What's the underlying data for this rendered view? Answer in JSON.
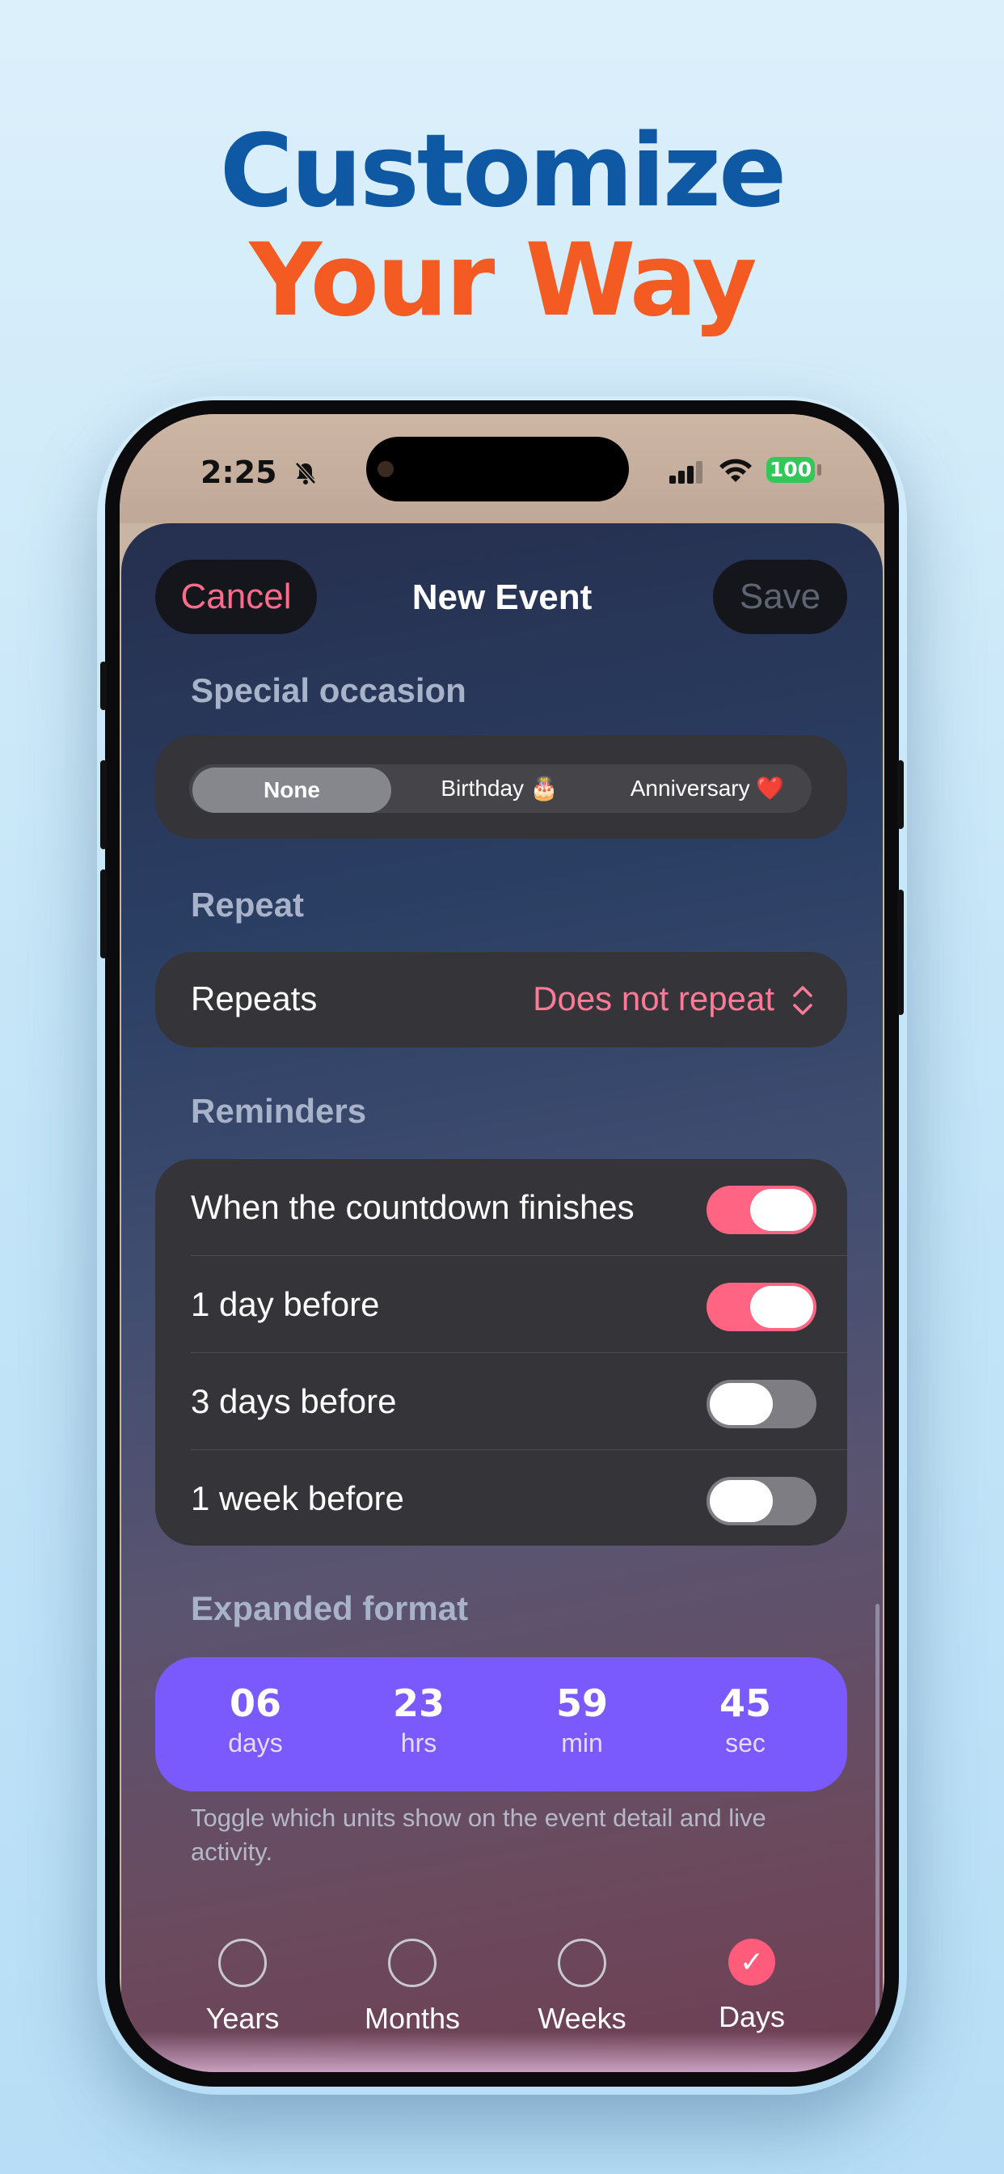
{
  "headline": {
    "line1": "Customize",
    "line2": "Your Way",
    "line1_color": "#0e58a4",
    "line2_color": "#f35b22"
  },
  "status_bar": {
    "time": "2:25",
    "battery": "100",
    "silent_icon": "bell-slash-icon"
  },
  "nav": {
    "cancel": "Cancel",
    "title": "New Event",
    "save": "Save"
  },
  "special_occasion": {
    "label": "Special occasion",
    "options": [
      "None",
      "Birthday 🎂",
      "Anniversary ❤️"
    ],
    "selected": "None"
  },
  "repeat": {
    "label": "Repeat",
    "row_label": "Repeats",
    "value": "Does not repeat"
  },
  "reminders": {
    "label": "Reminders",
    "items": [
      {
        "label": "When the countdown finishes",
        "on": true
      },
      {
        "label": "1 day before",
        "on": true
      },
      {
        "label": "3 days before",
        "on": false
      },
      {
        "label": "1 week before",
        "on": false
      }
    ]
  },
  "expanded_format": {
    "label": "Expanded format",
    "units": [
      {
        "value": "06",
        "unit": "days"
      },
      {
        "value": "23",
        "unit": "hrs"
      },
      {
        "value": "59",
        "unit": "min"
      },
      {
        "value": "45",
        "unit": "sec"
      }
    ],
    "hint": "Toggle which units show on the event detail and live activity.",
    "accent": "#7a5afc"
  },
  "unit_options": [
    {
      "label": "Years",
      "checked": false
    },
    {
      "label": "Months",
      "checked": false
    },
    {
      "label": "Weeks",
      "checked": false
    },
    {
      "label": "Days",
      "checked": true
    }
  ],
  "colors": {
    "toggle_on": "#ff6582",
    "cancel_text": "#ff6b8a",
    "check": "#ff5b7a"
  }
}
